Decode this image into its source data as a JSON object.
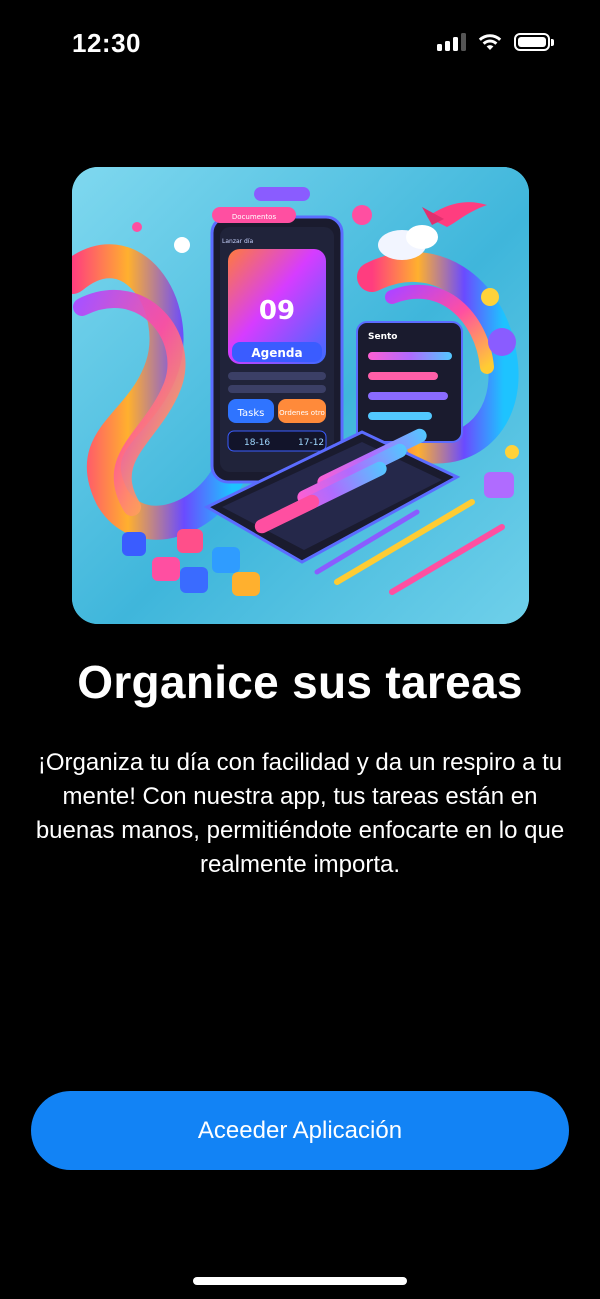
{
  "status_bar": {
    "time": "12:30",
    "icons": [
      "cellular-signal-icon",
      "wifi-icon",
      "battery-icon"
    ],
    "battery_level": 1.0
  },
  "hero_image": {
    "screen_number": "09",
    "screen_label": "Agenda",
    "tasks_label": "Tasks",
    "time_range": "18-16",
    "time_right": "17-12",
    "orange_button": "Ordenes otro",
    "side_panel_title": "Sento",
    "top_pill": "Documentos",
    "side_label": "Lanzar día"
  },
  "onboarding": {
    "title": "Organice sus tareas",
    "description": "¡Organiza tu día con facilidad y da un respiro a tu mente! Con nuestra app, tus tareas están en buenas manos, permitiéndote enfocarte en lo que realmente importa."
  },
  "cta": {
    "label": "Aceeder Aplicación"
  },
  "colors": {
    "background": "#000000",
    "accent": "#1283f5",
    "text": "#ffffff"
  }
}
